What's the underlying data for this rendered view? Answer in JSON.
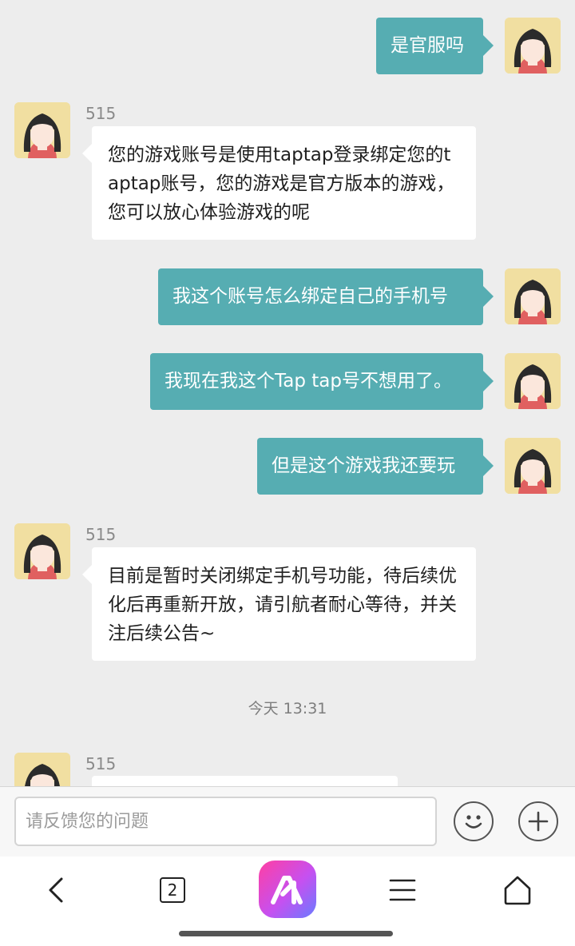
{
  "chat": {
    "messages": [
      {
        "from": "me",
        "text": "是官服吗"
      },
      {
        "from": "them",
        "sender": "515",
        "text": "您的游戏账号是使用taptap登录绑定您的taptap账号，您的游戏是官方版本的游戏，您可以放心体验游戏的呢"
      },
      {
        "from": "me",
        "text": "我这个账号怎么绑定自己的手机号"
      },
      {
        "from": "me",
        "text": "我现在我这个Tap tap号不想用了。"
      },
      {
        "from": "me",
        "text": "但是这个游戏我还要玩"
      },
      {
        "from": "them",
        "sender": "515",
        "text": "目前是暂时关闭绑定手机号功能，待后续优化后再重新开放，请引航者耐心等待，并关注后续公告~"
      },
      {
        "from": "them",
        "sender": "515",
        "text": ""
      }
    ],
    "timestamp": "今天 13:31"
  },
  "input": {
    "placeholder": "请反馈您的问题",
    "emoji_icon": "emoji-icon",
    "plus_icon": "plus-icon"
  },
  "nav": {
    "tab_count": "2",
    "icons": [
      "back-icon",
      "tabs-icon",
      "app-logo-icon",
      "menu-icon",
      "home-icon"
    ]
  },
  "colors": {
    "my_bubble": "#56adb2",
    "their_bubble": "#ffffff",
    "background": "#ededed"
  }
}
